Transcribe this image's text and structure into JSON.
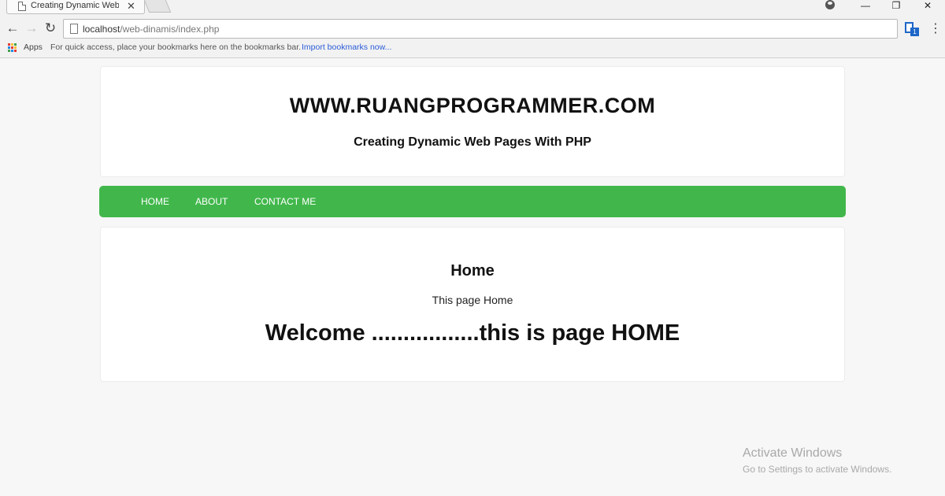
{
  "browser": {
    "tab_title": "Creating Dynamic Web P",
    "tab_close": "✕",
    "url_host": "localhost",
    "url_path": "/web-dinamis/index.php",
    "back_icon": "←",
    "forward_icon": "→",
    "reload_icon": "↻",
    "menu_icon": "⋮",
    "minimize": "—",
    "restore": "❐",
    "close": "✕",
    "bookmarks": {
      "apps_label": "Apps",
      "hint": "For quick access, place your bookmarks here on the bookmarks bar.",
      "import_link": "Import bookmarks now..."
    },
    "extension_badge": "1"
  },
  "site": {
    "title": "WWW.RUANGPROGRAMMER.COM",
    "subtitle": "Creating Dynamic Web Pages With PHP"
  },
  "nav": {
    "items": [
      {
        "label": "HOME"
      },
      {
        "label": "ABOUT"
      },
      {
        "label": "CONTACT ME"
      }
    ],
    "color": "#41b74b"
  },
  "content": {
    "heading": "Home",
    "text": "This page Home",
    "welcome": "Welcome .................this is page HOME"
  },
  "watermark": {
    "line1": "Activate Windows",
    "line2": "Go to Settings to activate Windows."
  }
}
